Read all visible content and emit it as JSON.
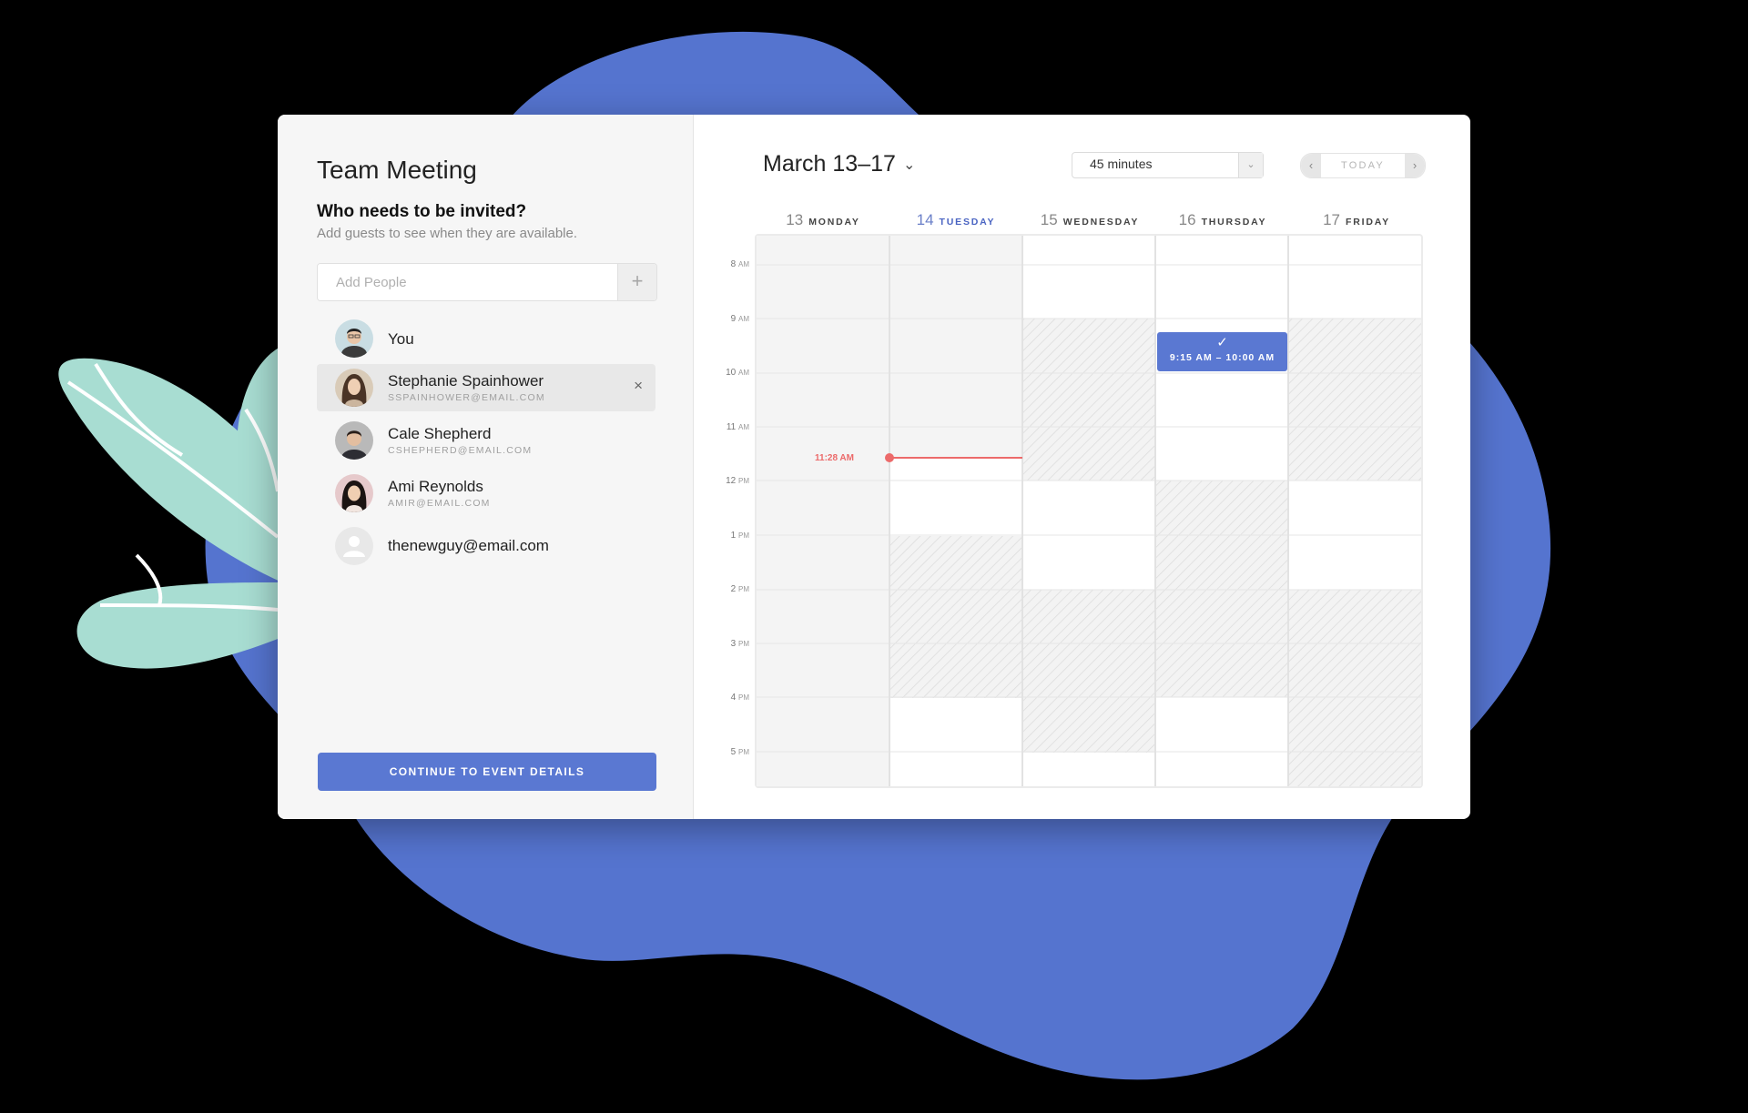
{
  "left_panel": {
    "title": "Team Meeting",
    "question": "Who needs to be invited?",
    "hint": "Add guests to see when they are available.",
    "add_people_placeholder": "Add People",
    "add_button": "+",
    "people": [
      {
        "name": "You",
        "email": ""
      },
      {
        "name": "Stephanie Spainhower",
        "email": "SSPAINHOWER@EMAIL.COM",
        "selected": true
      },
      {
        "name": "Cale Shepherd",
        "email": "CSHEPHERD@EMAIL.COM"
      },
      {
        "name": "Ami Reynolds",
        "email": "AMIR@EMAIL.COM"
      },
      {
        "name": "thenewguy@email.com",
        "email": ""
      }
    ],
    "remove_icon": "×",
    "continue_label": "CONTINUE TO EVENT DETAILS"
  },
  "calendar": {
    "range_label": "March 13–17",
    "range_chevron": "⌄",
    "duration": "45 minutes",
    "duration_arrow": "⌄",
    "nav": {
      "prev": "‹",
      "today": "TODAY",
      "next": "›"
    },
    "days": [
      {
        "num": "13",
        "name": "MONDAY"
      },
      {
        "num": "14",
        "name": "TUESDAY",
        "is_today": true
      },
      {
        "num": "15",
        "name": "WEDNESDAY"
      },
      {
        "num": "16",
        "name": "THURSDAY"
      },
      {
        "num": "17",
        "name": "FRIDAY"
      }
    ],
    "hours": [
      {
        "n": "8",
        "m": "AM"
      },
      {
        "n": "9",
        "m": "AM"
      },
      {
        "n": "10",
        "m": "AM"
      },
      {
        "n": "11",
        "m": "AM"
      },
      {
        "n": "12",
        "m": "PM"
      },
      {
        "n": "1",
        "m": "PM"
      },
      {
        "n": "2",
        "m": "PM"
      },
      {
        "n": "3",
        "m": "PM"
      },
      {
        "n": "4",
        "m": "PM"
      },
      {
        "n": "5",
        "m": "PM"
      }
    ],
    "now_label": "11:28 AM",
    "event": {
      "check": "✓",
      "time": "9:15 AM – 10:00 AM"
    }
  },
  "colors": {
    "accent": "#5a78d2",
    "now_line": "#ec6a6a",
    "background_blob": "#5574cf",
    "leaf": "#a8ddd2"
  }
}
